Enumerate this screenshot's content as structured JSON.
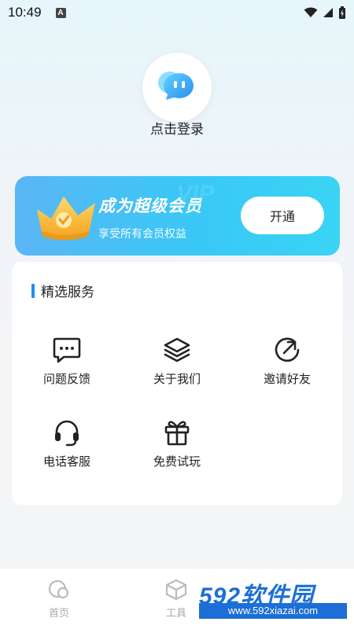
{
  "status_bar": {
    "time": "10:49",
    "badge": "A"
  },
  "profile": {
    "login_label": "点击登录"
  },
  "vip": {
    "title": "成为超级会员",
    "subtitle": "享受所有会员权益",
    "button_label": "开通",
    "watermark": "VIP",
    "gradient_start": "#5ab6f5",
    "gradient_end": "#3ad4f5"
  },
  "services": {
    "heading": "精选服务",
    "accent_color": "#1f8df5",
    "items": [
      {
        "label": "问题反馈",
        "icon": "feedback-message-icon"
      },
      {
        "label": "关于我们",
        "icon": "layers-icon"
      },
      {
        "label": "邀请好友",
        "icon": "share-arrow-icon"
      },
      {
        "label": "电话客服",
        "icon": "headset-icon"
      },
      {
        "label": "免费试玩",
        "icon": "gift-icon"
      }
    ]
  },
  "tabbar": {
    "tabs": [
      {
        "label": "首页",
        "icon": "home-icon"
      },
      {
        "label": "工具",
        "icon": "box-icon"
      }
    ]
  },
  "watermark": {
    "brand": "592软件园",
    "url": "www.592xiazai.com"
  }
}
